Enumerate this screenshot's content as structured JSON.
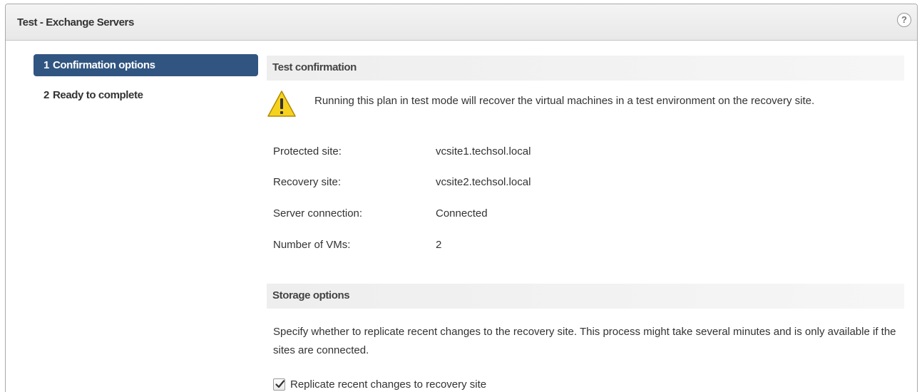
{
  "dialog": {
    "title": "Test - Exchange Servers",
    "help_label": "?"
  },
  "nav": {
    "items": [
      {
        "num": "1",
        "label": "Confirmation options",
        "active": true
      },
      {
        "num": "2",
        "label": "Ready to complete",
        "active": false
      }
    ]
  },
  "test_confirmation": {
    "header": "Test confirmation",
    "warning_text": "Running this plan in test mode will recover the virtual machines in a test environment on the recovery site.",
    "fields": [
      {
        "label": "Protected site:",
        "value": "vcsite1.techsol.local"
      },
      {
        "label": "Recovery site:",
        "value": "vcsite2.techsol.local"
      },
      {
        "label": "Server connection:",
        "value": "Connected"
      },
      {
        "label": "Number of VMs:",
        "value": "2"
      }
    ]
  },
  "storage_options": {
    "header": "Storage options",
    "description": "Specify whether to replicate recent changes to the recovery site. This process might take several minutes and is only available if the sites are connected.",
    "checkbox_label": "Replicate recent changes to recovery site",
    "checkbox_checked": true
  },
  "icons": {
    "help": "help-icon",
    "warning": "warning-icon",
    "check": "checkmark-icon"
  },
  "colors": {
    "nav_active_bg": "#315581",
    "warning_fill": "#f7d21d"
  }
}
